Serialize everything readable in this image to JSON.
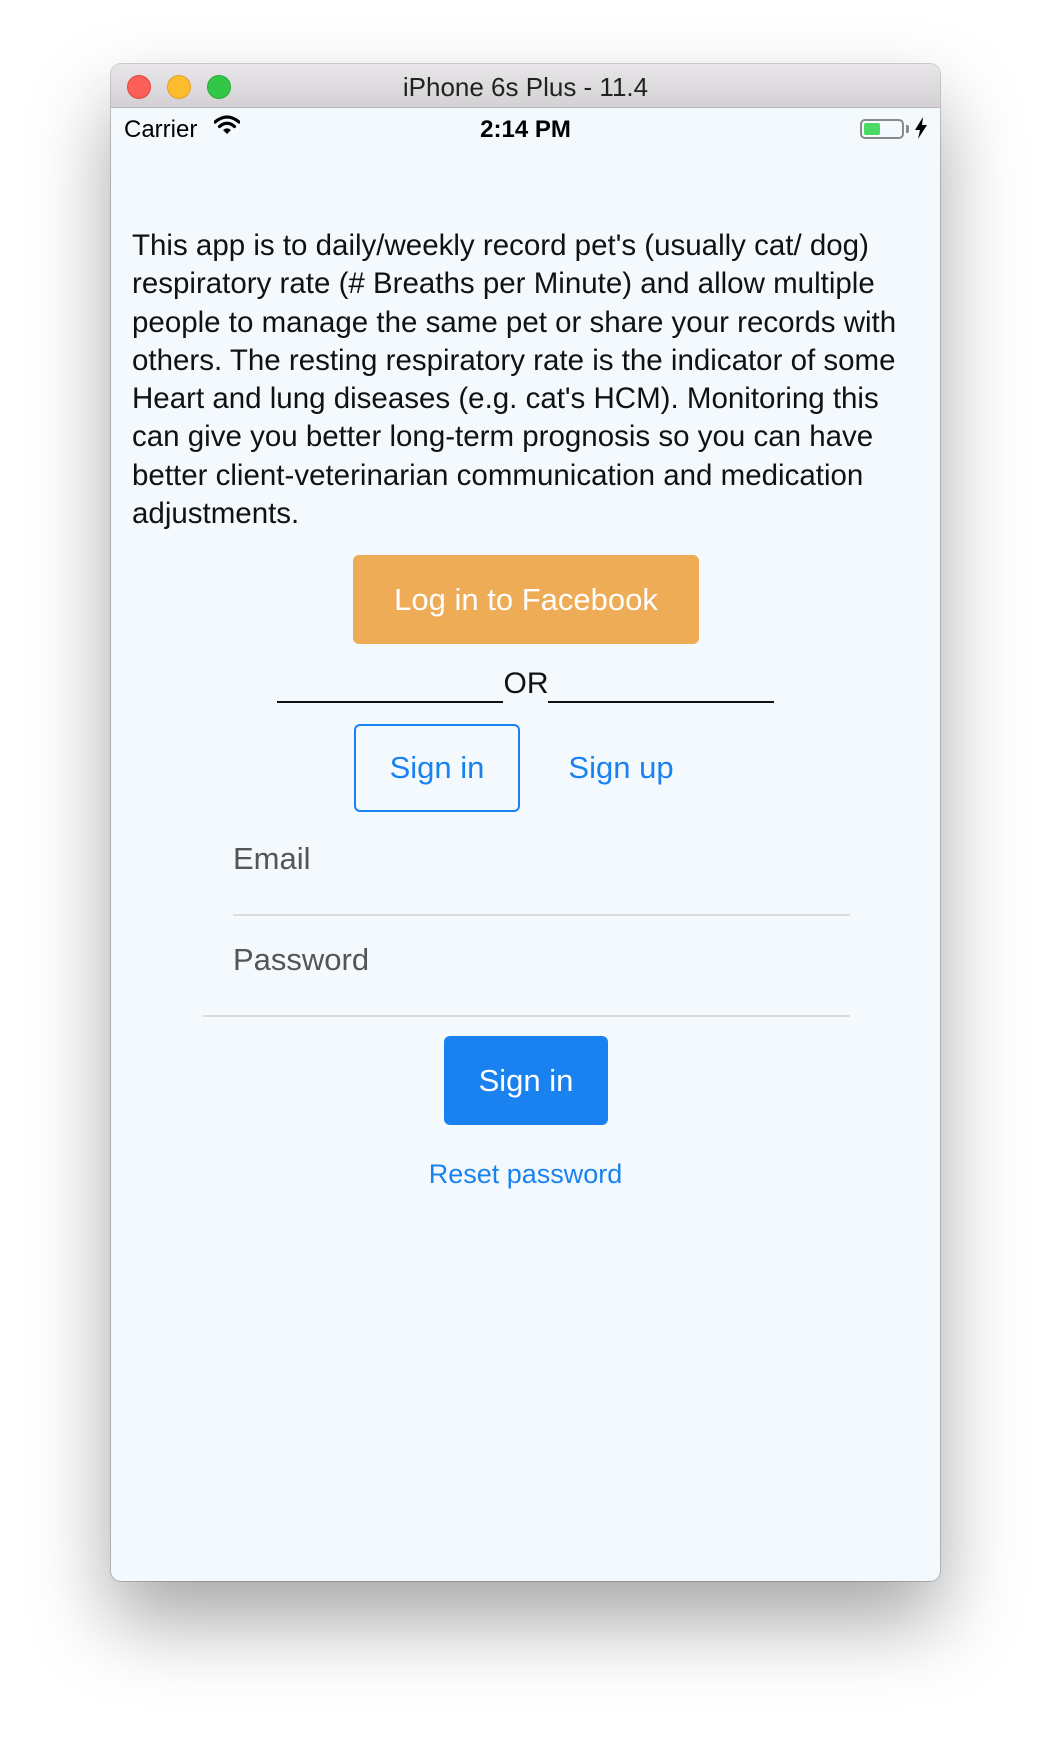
{
  "window": {
    "title": "iPhone 6s Plus - 11.4"
  },
  "status_bar": {
    "carrier": "Carrier",
    "time": "2:14 PM",
    "battery_level": 0.45,
    "charging": true
  },
  "intro": {
    "text": "This app is to daily/weekly record pet's (usually cat/ dog) respiratory rate (# Breaths per Minute) and allow multiple people to manage the same pet or share your records with others. The resting respiratory rate is the indicator of some Heart and lung diseases (e.g. cat's HCM). Monitoring this can give you better long-term prognosis so you can have better client-veterinarian communication and medication adjustments."
  },
  "facebook_button": {
    "label": "Log in to Facebook"
  },
  "separator": {
    "label": "OR"
  },
  "tabs": {
    "sign_in": "Sign in",
    "sign_up": "Sign up",
    "selected": "sign_in"
  },
  "form": {
    "email_placeholder": "Email",
    "email_value": "",
    "password_placeholder": "Password",
    "password_value": ""
  },
  "submit_button": {
    "label": "Sign in"
  },
  "reset_link": {
    "label": "Reset password"
  },
  "colors": {
    "facebook_button": "#efac57",
    "accent_blue": "#1a82f0",
    "background": "#f3f9fd",
    "battery_fill": "#4cd964"
  },
  "icons": {
    "wifi": "wifi-icon",
    "bolt": "charging-bolt-icon"
  }
}
